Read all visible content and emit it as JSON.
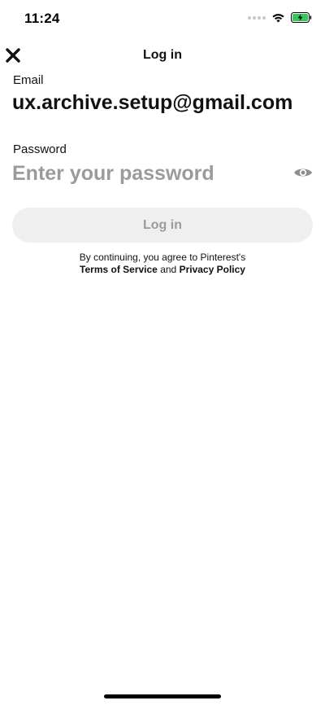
{
  "status_bar": {
    "time": "11:24",
    "icons": [
      "signal-icon",
      "wifi-icon",
      "battery-charging-icon"
    ],
    "battery_color": "#34c759"
  },
  "header": {
    "title": "Log in",
    "close_icon": "close-icon"
  },
  "form": {
    "email_label": "Email",
    "email_value": "ux.archive.setup@gmail.com",
    "password_label": "Password",
    "password_placeholder": "Enter your password",
    "password_value": "",
    "show_password_icon": "eye-icon"
  },
  "login_button": {
    "label": "Log in",
    "disabled": true
  },
  "terms": {
    "prefix": "By continuing, you agree to Pinterest's",
    "terms_link": "Terms of Service",
    "connector": "and",
    "privacy_link": "Privacy Policy"
  },
  "colors": {
    "text": "#111111",
    "placeholder": "#9b9b9b",
    "button_disabled_bg": "#efefef"
  }
}
